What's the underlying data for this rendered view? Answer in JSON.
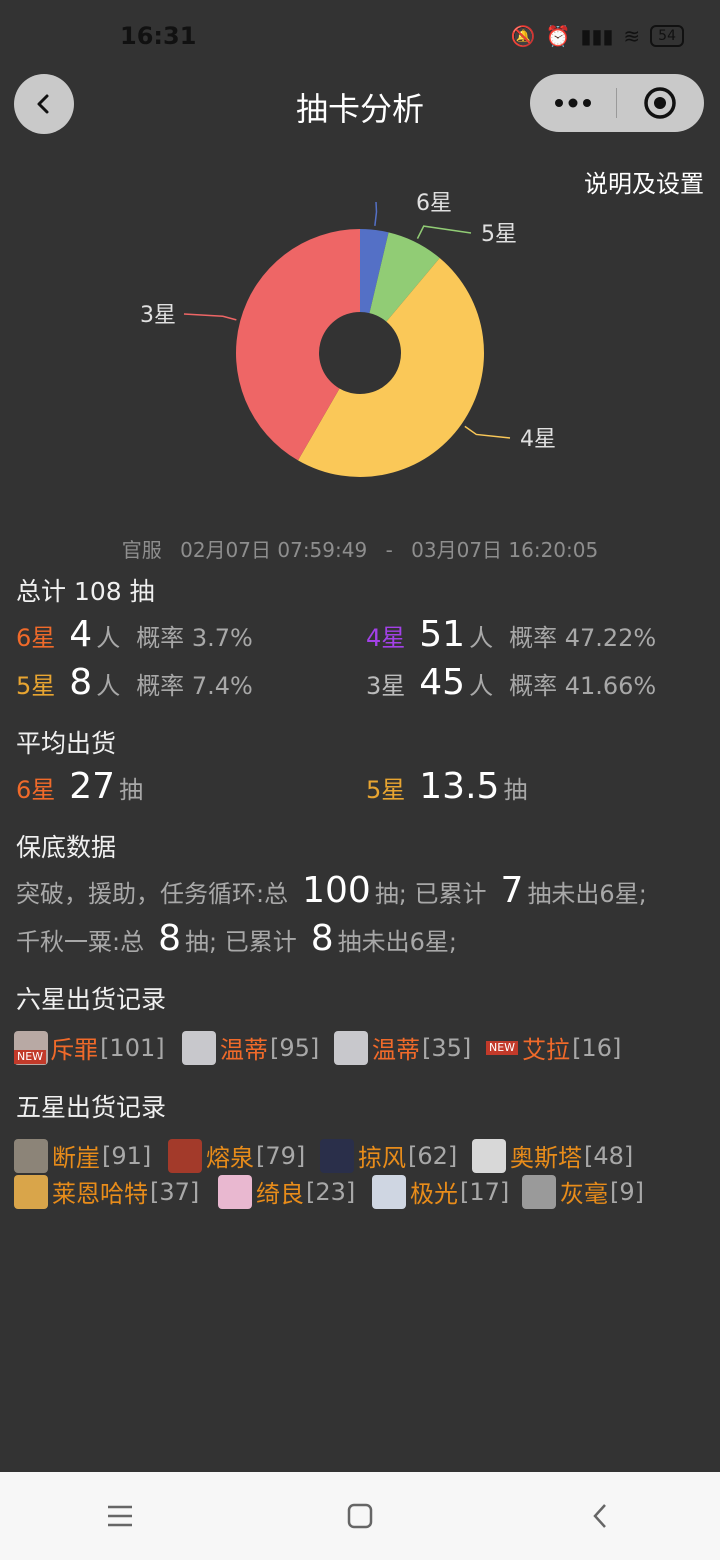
{
  "status": {
    "time": "16:31",
    "battery": "54"
  },
  "nav": {
    "title": "抽卡分析",
    "settings": "说明及设置"
  },
  "chart_data": {
    "type": "pie",
    "categories": [
      "6星",
      "5星",
      "4星",
      "3星"
    ],
    "values": [
      4,
      8,
      51,
      45
    ],
    "colors": [
      "#5470c6",
      "#91cc75",
      "#fac858",
      "#ee6666"
    ],
    "donut": true
  },
  "range": {
    "server": "官服",
    "start": "02月07日 07:59:49",
    "dash": "-",
    "end": "03月07日 16:20:05"
  },
  "total": {
    "label": "总计 108 抽"
  },
  "stats": {
    "s6": {
      "label": "6星",
      "count": "4",
      "unit": "人",
      "rate": "概率 3.7%"
    },
    "s4": {
      "label": "4星",
      "count": "51",
      "unit": "人",
      "rate": "概率 47.22%"
    },
    "s5": {
      "label": "5星",
      "count": "8",
      "unit": "人",
      "rate": "概率 7.4%"
    },
    "s3": {
      "label": "3星",
      "count": "45",
      "unit": "人",
      "rate": "概率 41.66%"
    }
  },
  "avg": {
    "heading": "平均出货",
    "a6": {
      "label": "6星",
      "value": "27",
      "unit": "抽"
    },
    "a5": {
      "label": "5星",
      "value": "13.5",
      "unit": "抽"
    }
  },
  "pity": {
    "heading": "保底数据",
    "line1": {
      "pre": "突破，援助，任务循环:总",
      "total": "100",
      "mid": "抽; 已累计",
      "acc": "7",
      "post": "抽未出6星;"
    },
    "line2": {
      "pre": "千秋一粟:总",
      "total": "8",
      "mid": "抽; 已累计",
      "acc": "8",
      "post": "抽未出6星;"
    }
  },
  "six_records": {
    "heading": "六星出货记录",
    "items": [
      {
        "name": "斥罪",
        "count": "[101]",
        "new": "NEW"
      },
      {
        "name": "温蒂",
        "count": "[95]"
      },
      {
        "name": "温蒂",
        "count": "[35]"
      },
      {
        "name": "艾拉",
        "count": "[16]",
        "new": "NEW"
      }
    ]
  },
  "five_records": {
    "heading": "五星出货记录",
    "items": [
      {
        "name": "断崖",
        "count": "[91]"
      },
      {
        "name": "熔泉",
        "count": "[79]"
      },
      {
        "name": "掠风",
        "count": "[62]"
      },
      {
        "name": "奥斯塔",
        "count": "[48]"
      },
      {
        "name": "莱恩哈特",
        "count": "[37]"
      },
      {
        "name": "绮良",
        "count": "[23]"
      },
      {
        "name": "极光",
        "count": "[17]"
      },
      {
        "name": "灰毫",
        "count": "[9]"
      }
    ]
  },
  "icons": [
    "back-icon",
    "more-icon",
    "target-icon",
    "menu-icon",
    "home-icon",
    "nav-back-icon"
  ]
}
